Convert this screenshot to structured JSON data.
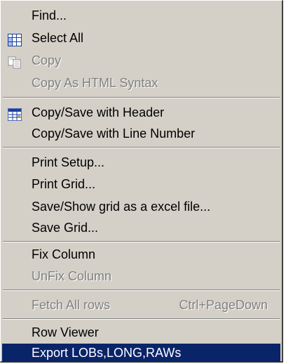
{
  "menu": {
    "find": "Find...",
    "select_all": "Select All",
    "copy": "Copy",
    "copy_html": "Copy As HTML Syntax",
    "copy_save_header": "Copy/Save with Header",
    "copy_save_line": "Copy/Save with Line Number",
    "print_setup": "Print Setup...",
    "print_grid": "Print Grid...",
    "save_show_excel": "Save/Show grid as a excel file...",
    "save_grid": "Save Grid...",
    "fix_column": "Fix Column",
    "unfix_column": "UnFix Column",
    "fetch_all_rows": "Fetch All rows",
    "fetch_all_rows_shortcut": "Ctrl+PageDown",
    "row_viewer": "Row Viewer",
    "export_lobs": "Export LOBs,LONG,RAWs"
  },
  "colors": {
    "menu_bg": "#d4d0c8",
    "selected_bg": "#0a246a",
    "disabled_text": "#808080"
  },
  "icons": {
    "select_all": "select-all-grid-icon",
    "copy": "copy-icon",
    "copy_save_header": "table-header-icon"
  }
}
